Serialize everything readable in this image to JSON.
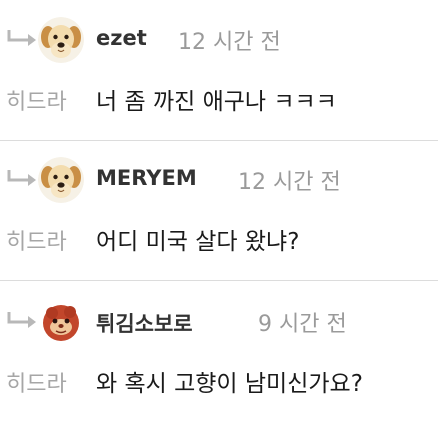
{
  "comments": [
    {
      "username": "ezet",
      "time": "12 시간 전",
      "target": "히드라",
      "message": "너 좀 까진 애구나 ㅋㅋㅋ",
      "avatar_icon": "puppy-avatar"
    },
    {
      "username": "MERYEM",
      "time": "12 시간 전",
      "target": "히드라",
      "message": "어디 미국 살다 왔냐?",
      "avatar_icon": "puppy-avatar"
    },
    {
      "username": "튀김소보로",
      "time": "9 시간 전",
      "target": "히드라",
      "message": "와 혹시 고향이 남미신가요?",
      "avatar_icon": "creature-avatar"
    }
  ],
  "colors": {
    "username": "#333333",
    "time": "#9a9a9a",
    "target": "#a6a6a6",
    "message": "#1a1a1a",
    "divider": "#dcdcdc"
  }
}
